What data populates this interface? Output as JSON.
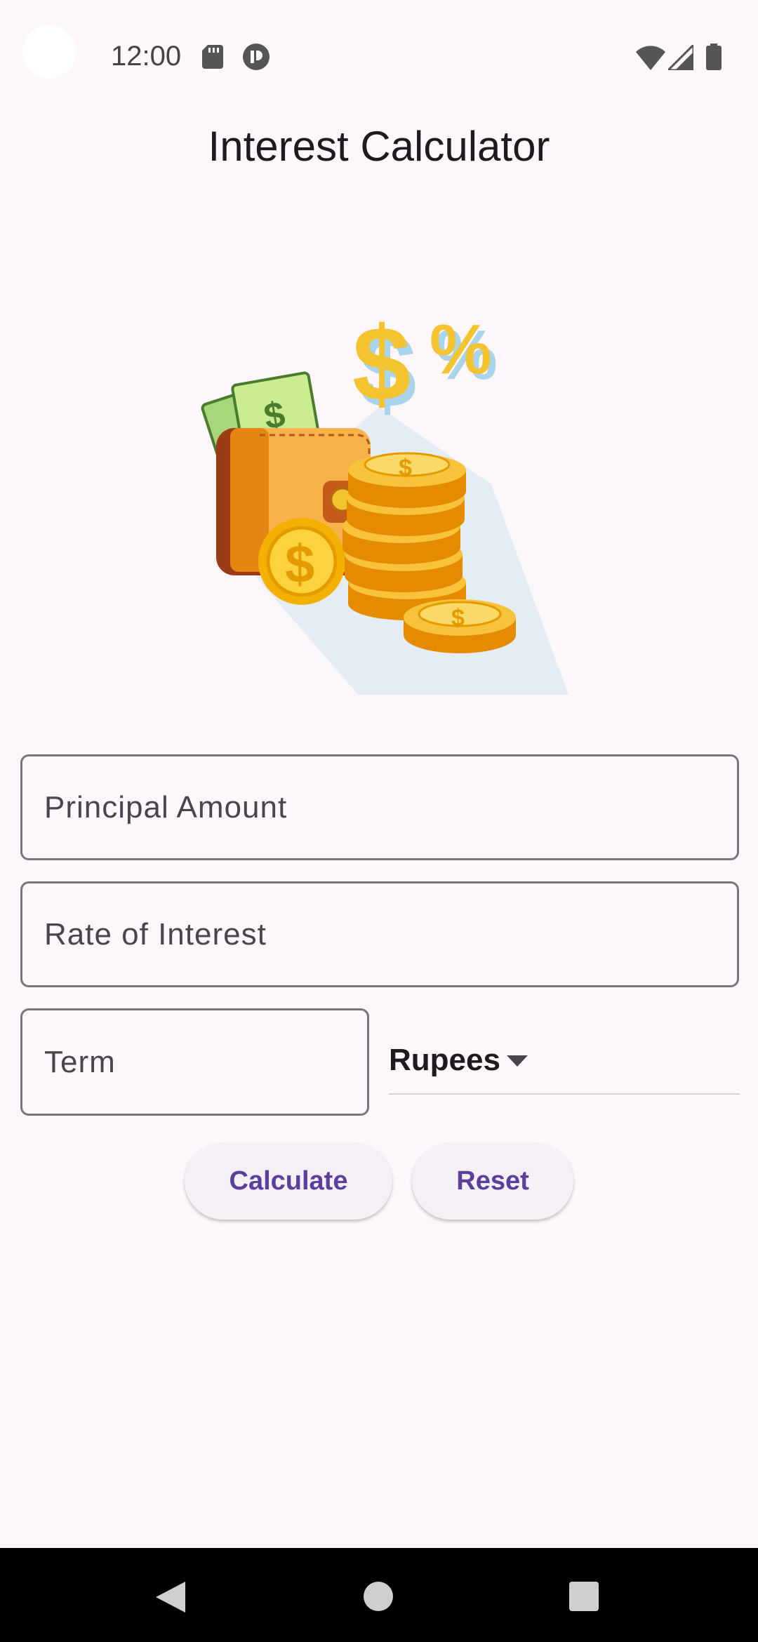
{
  "status_bar": {
    "time": "12:00",
    "icons": [
      "sd-card-icon",
      "p-badge-icon",
      "wifi-icon",
      "signal-icon",
      "battery-icon"
    ]
  },
  "app": {
    "title": "Interest Calculator"
  },
  "illustration": {
    "icon": "wallet-coins-illustration"
  },
  "form": {
    "principal_placeholder": "Principal Amount",
    "rate_placeholder": "Rate of Interest",
    "term_placeholder": "Term",
    "currency_selected": "Rupees"
  },
  "buttons": {
    "calculate": "Calculate",
    "reset": "Reset"
  },
  "colors": {
    "accent": "#5a3f9c",
    "background": "#fdf7fb",
    "outline": "#79747e"
  },
  "nav": {
    "icons": [
      "back-icon",
      "home-icon",
      "recents-icon"
    ]
  }
}
